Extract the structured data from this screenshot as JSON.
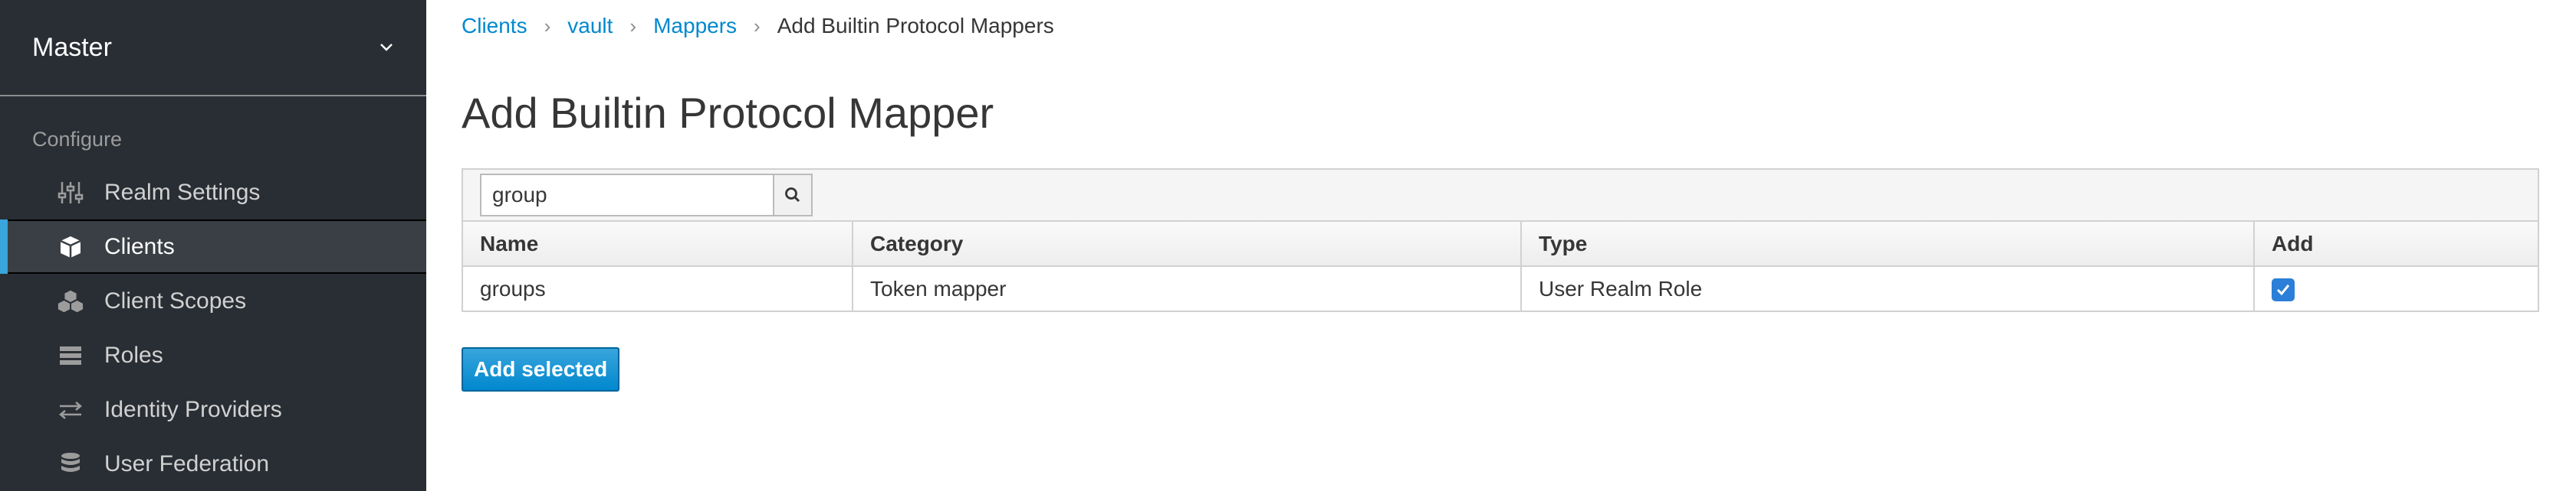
{
  "sidebar": {
    "realm": "Master",
    "section": "Configure",
    "items": [
      {
        "label": "Realm Settings",
        "icon": "sliders-icon",
        "active": false
      },
      {
        "label": "Clients",
        "icon": "cube-icon",
        "active": true
      },
      {
        "label": "Client Scopes",
        "icon": "cubes-icon",
        "active": false
      },
      {
        "label": "Roles",
        "icon": "list-icon",
        "active": false
      },
      {
        "label": "Identity Providers",
        "icon": "exchange-icon",
        "active": false
      },
      {
        "label": "User Federation",
        "icon": "database-icon",
        "active": false
      }
    ]
  },
  "breadcrumb": {
    "items": [
      "Clients",
      "vault",
      "Mappers"
    ],
    "current": "Add Builtin Protocol Mappers"
  },
  "page": {
    "title": "Add Builtin Protocol Mapper"
  },
  "search": {
    "value": "group"
  },
  "table": {
    "headers": [
      "Name",
      "Category",
      "Type",
      "Add"
    ],
    "rows": [
      {
        "name": "groups",
        "category": "Token mapper",
        "type": "User Realm Role",
        "add": true
      }
    ]
  },
  "actions": {
    "add_selected": "Add selected"
  },
  "colors": {
    "sidebar_bg": "#292e34",
    "accent": "#39a5dc",
    "link": "#0088ce",
    "primary_button": "#0088ce"
  }
}
